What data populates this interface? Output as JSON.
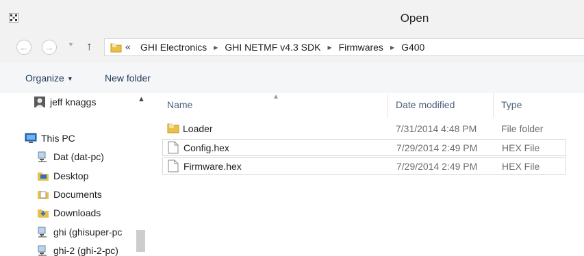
{
  "window": {
    "title": "Open"
  },
  "nav": {
    "back_label": "←",
    "forward_label": "→",
    "up_label": "↑"
  },
  "address": {
    "overflow": "«",
    "crumbs": [
      "GHI Electronics",
      "GHI NETMF v4.3 SDK",
      "Firmwares",
      "G400"
    ]
  },
  "toolbar": {
    "organize_label": "Organize",
    "new_folder_label": "New folder"
  },
  "navpane": {
    "items": [
      {
        "label": "jeff knaggs",
        "icon": "user-icon"
      },
      {
        "label": "This PC",
        "icon": "computer-icon"
      },
      {
        "label": "Dat (dat-pc)",
        "icon": "network-drive-icon"
      },
      {
        "label": "Desktop",
        "icon": "desktop-folder-icon"
      },
      {
        "label": "Documents",
        "icon": "documents-folder-icon"
      },
      {
        "label": "Downloads",
        "icon": "downloads-folder-icon"
      },
      {
        "label": "ghi (ghisuper-pc",
        "icon": "network-drive-icon"
      },
      {
        "label": "ghi-2 (ghi-2-pc)",
        "icon": "network-drive-icon"
      }
    ]
  },
  "columns": {
    "name": "Name",
    "date": "Date modified",
    "type": "Type"
  },
  "files": [
    {
      "name": "Loader",
      "date": "7/31/2014 4:48 PM",
      "type": "File folder",
      "icon": "folder-icon"
    },
    {
      "name": "Config.hex",
      "date": "7/29/2014 2:49 PM",
      "type": "HEX File",
      "icon": "file-icon"
    },
    {
      "name": "Firmware.hex",
      "date": "7/29/2014 2:49 PM",
      "type": "HEX File",
      "icon": "file-icon"
    }
  ],
  "colors": {
    "folder": "#e9c04a",
    "toolbar_text": "#1e395b",
    "header_text": "#4c607a"
  }
}
